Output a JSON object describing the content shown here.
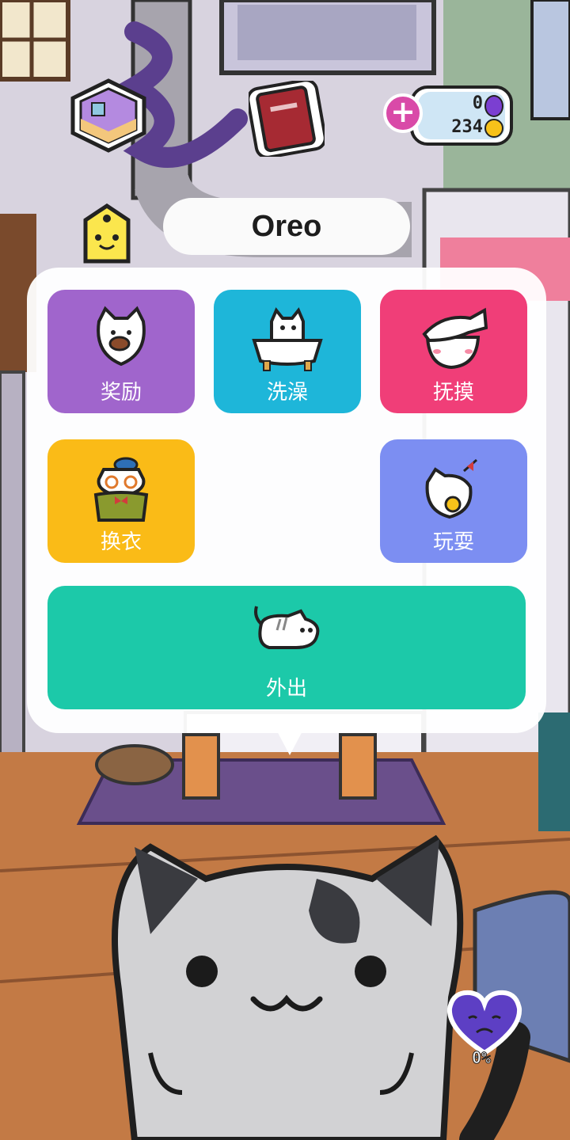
{
  "pet": {
    "name": "Oreo"
  },
  "currency": {
    "gems": "0",
    "coins": "234"
  },
  "menu": {
    "reward": "奖励",
    "bath": "洗澡",
    "pet": "抚摸",
    "dress": "换衣",
    "play": "玩耍",
    "go_out": "外出"
  },
  "status": {
    "mood_percent": "0%"
  },
  "colors": {
    "reward": "#a065cc",
    "bath": "#1eb6d9",
    "pet": "#f03e78",
    "dress": "#fabb17",
    "play": "#7c8ef2",
    "go_out": "#1cc9a9",
    "currency_add": "#d94aa8"
  }
}
